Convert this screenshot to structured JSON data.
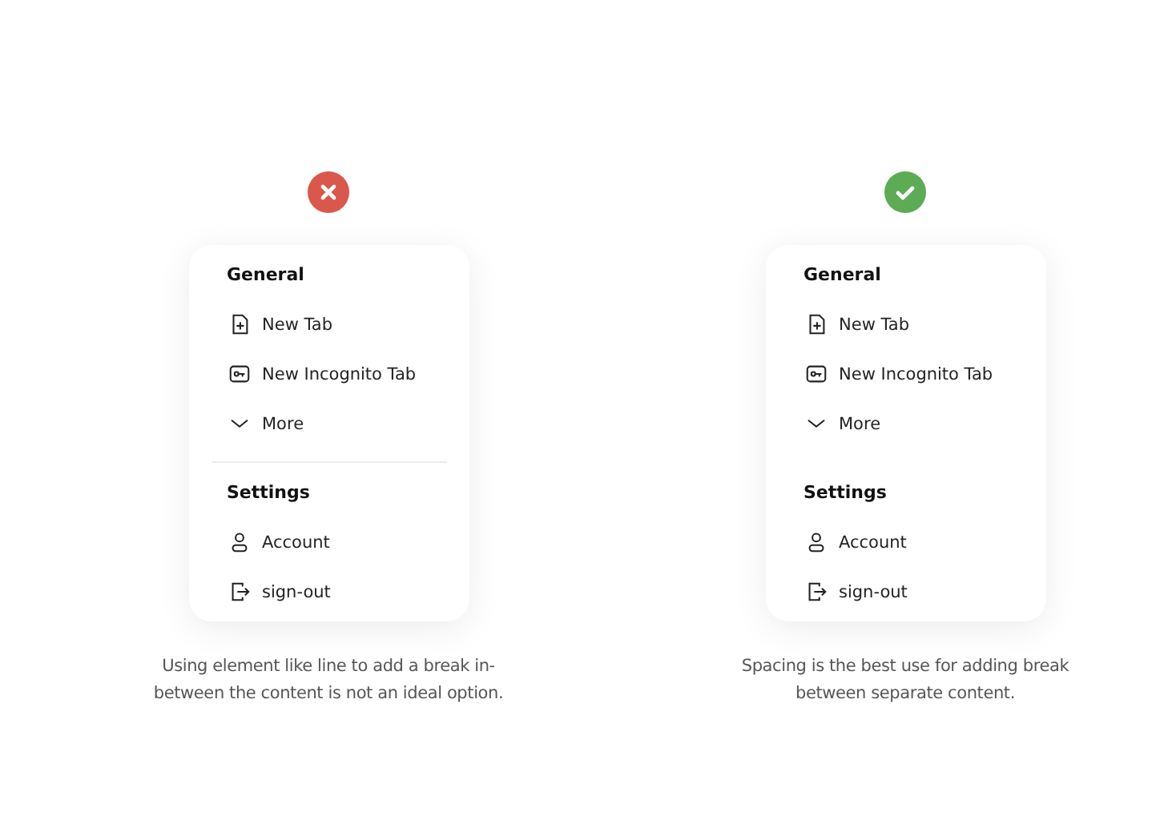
{
  "examples": [
    {
      "kind": "bad",
      "divider": true,
      "sections": [
        {
          "title": "General",
          "items": [
            {
              "kind": "new-tab",
              "label": "New Tab"
            },
            {
              "kind": "incognito",
              "label": "New Incognito Tab"
            },
            {
              "kind": "more",
              "label": "More"
            }
          ]
        },
        {
          "title": "Settings",
          "items": [
            {
              "kind": "account",
              "label": "Account"
            },
            {
              "kind": "sign-out",
              "label": "sign-out"
            }
          ]
        }
      ],
      "caption": [
        "Using element like line to add a break in-",
        "between the content is not an ideal option."
      ]
    },
    {
      "kind": "good",
      "divider": false,
      "sections": [
        {
          "title": "General",
          "items": [
            {
              "kind": "new-tab",
              "label": "New Tab"
            },
            {
              "kind": "incognito",
              "label": "New Incognito Tab"
            },
            {
              "kind": "more",
              "label": "More"
            }
          ]
        },
        {
          "title": "Settings",
          "items": [
            {
              "kind": "account",
              "label": "Account"
            },
            {
              "kind": "sign-out",
              "label": "sign-out"
            }
          ]
        }
      ],
      "caption": [
        "Spacing is the best use for adding break",
        "between separate content."
      ]
    }
  ]
}
